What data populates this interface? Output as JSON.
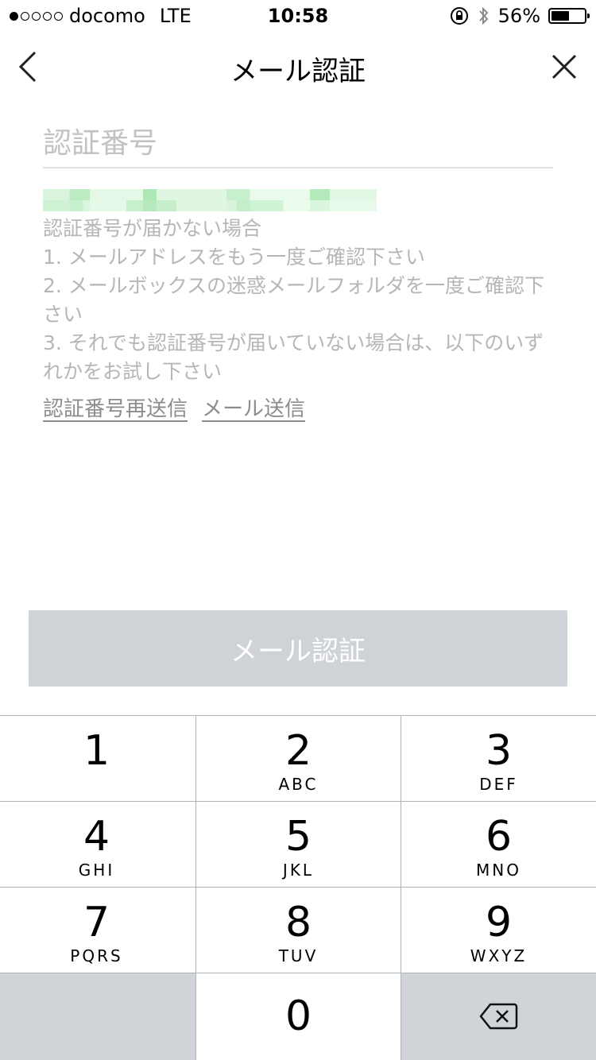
{
  "status_bar": {
    "carrier": "docomo",
    "network": "LTE",
    "time": "10:58",
    "battery": "56%",
    "battery_level": 0.56,
    "icons": [
      "rotation-lock-icon",
      "bluetooth-icon"
    ]
  },
  "nav": {
    "title": "メール認証",
    "back_icon": "chevron-left-icon",
    "close_icon": "close-icon"
  },
  "form": {
    "code_placeholder": "認証番号",
    "code_value": ""
  },
  "help": {
    "heading": "認証番号が届かない場合",
    "item1": "1. メールアドレスをもう一度ご確認下さい",
    "item2": "2. メールボックスの迷惑メールフォルダを一度ご確認下さい",
    "item3": "3. それでも認証番号が届いていない場合は、以下のいずれかをお試し下さい"
  },
  "links": {
    "resend": "認証番号再送信",
    "send_mail": "メール送信"
  },
  "submit_label": "メール認証",
  "keypad": {
    "keys": [
      {
        "num": "1",
        "letters": ""
      },
      {
        "num": "2",
        "letters": "ABC"
      },
      {
        "num": "3",
        "letters": "DEF"
      },
      {
        "num": "4",
        "letters": "GHI"
      },
      {
        "num": "5",
        "letters": "JKL"
      },
      {
        "num": "6",
        "letters": "MNO"
      },
      {
        "num": "7",
        "letters": "PQRS"
      },
      {
        "num": "8",
        "letters": "TUV"
      },
      {
        "num": "9",
        "letters": "WXYZ"
      },
      {
        "num": "0",
        "letters": ""
      }
    ],
    "delete_icon": "backspace-icon"
  }
}
